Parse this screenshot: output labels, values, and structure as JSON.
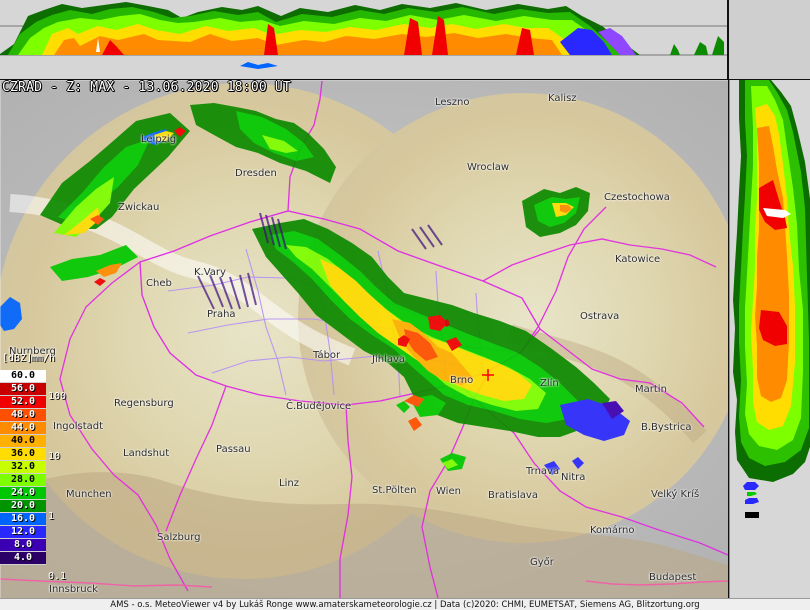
{
  "title": "CZRAD - Z: MAX - 13.06.2020 18:00 UT",
  "legend": {
    "unit_left": "[dBZ]",
    "unit_right": "mm/h",
    "levels": [
      {
        "dbz": "60.0",
        "color": "#ffffff"
      },
      {
        "dbz": "56.0",
        "color": "#c80000"
      },
      {
        "dbz": "52.0",
        "color": "#f00000"
      },
      {
        "dbz": "48.0",
        "color": "#ff4f00"
      },
      {
        "dbz": "44.0",
        "color": "#ff8c00"
      },
      {
        "dbz": "40.0",
        "color": "#ffb000"
      },
      {
        "dbz": "36.0",
        "color": "#ffdd00"
      },
      {
        "dbz": "32.0",
        "color": "#c8ff00"
      },
      {
        "dbz": "28.0",
        "color": "#7dff00"
      },
      {
        "dbz": "24.0",
        "color": "#00c800"
      },
      {
        "dbz": "20.0",
        "color": "#009400"
      },
      {
        "dbz": "16.0",
        "color": "#0064ff"
      },
      {
        "dbz": "12.0",
        "color": "#2828ff"
      },
      {
        "dbz": "8.0",
        "color": "#3c00b4"
      },
      {
        "dbz": "4.0",
        "color": "#2a0066"
      }
    ],
    "rain_marks": [
      "100",
      "10",
      "1",
      "0.1"
    ]
  },
  "cities": [
    "Leszno",
    "Kalisz",
    "Leipzig",
    "Wroclaw",
    "Dresden",
    "Zwickau",
    "Czestochowa",
    "Katowice",
    "Praha",
    "K.Vary",
    "Cheb",
    "Ostrava",
    "Nurnberg",
    "Tábor",
    "Jihlava",
    "Brno",
    "Zlín",
    "Martin",
    "Regensburg",
    "Ingolstadt",
    "Č.Budějovice",
    "B.Bystrica",
    "Passau",
    "Landshut",
    "Trnava",
    "Nitra",
    "Linz",
    "St.Pölten",
    "Wien",
    "Bratislava",
    "Velký Kríš",
    "Munchen",
    "Komárno",
    "Salzburg",
    "Győr",
    "Budapest",
    "Innsbruck"
  ],
  "footer": "AMS - o.s. MeteoViewer v4 by Lukáš Ronge www.amaterskameteorologie.cz | Data (c)2020: CHMI, EUMETSAT, Siemens AG, Blitzortung.org"
}
